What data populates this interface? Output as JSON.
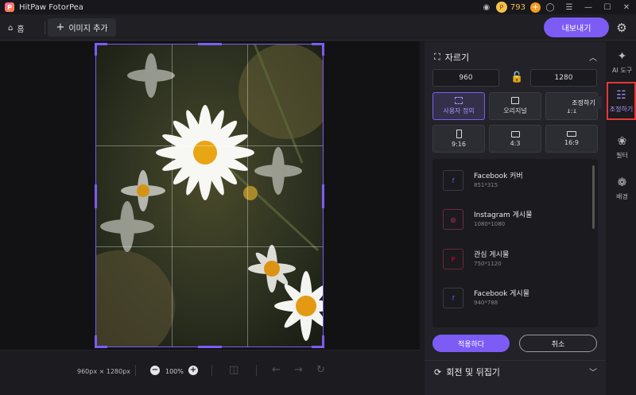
{
  "app": {
    "title": "HitPaw FotorPea"
  },
  "titlebar": {
    "coins": "793",
    "coin_symbol": "P",
    "plus": "+"
  },
  "toolbar": {
    "home_label": "홈",
    "add_image_label": "이미지 추가",
    "export_label": "내보내기"
  },
  "canvas": {
    "dimensions": "960px × 1280px",
    "zoom": "100%"
  },
  "crop_panel": {
    "title": "자르기",
    "width_value": "960",
    "height_value": "1280",
    "ratios": [
      {
        "label": "사용자 정의",
        "active": true
      },
      {
        "label": "오리지널",
        "active": false
      },
      {
        "label": "1:1",
        "active": false
      },
      {
        "label": "9:16",
        "active": false
      },
      {
        "label": "4:3",
        "active": false
      },
      {
        "label": "16:9",
        "active": false
      }
    ],
    "presets": [
      {
        "name": "Facebook 커버",
        "size": "851*315",
        "icon": "f",
        "color": "#3b6cf0"
      },
      {
        "name": "Instagram 게시물",
        "size": "1080*1080",
        "icon": "◎",
        "color": "#e1306c"
      },
      {
        "name": "관심 게시물",
        "size": "750*1120",
        "icon": "P",
        "color": "#e60023"
      },
      {
        "name": "Facebook 게시물",
        "size": "940*788",
        "icon": "f",
        "color": "#3b6cf0"
      }
    ],
    "apply_label": "적용하다",
    "cancel_label": "취소",
    "rotate_title": "회전 및 뒤집기"
  },
  "rail": {
    "items": [
      {
        "label": "AI 도구",
        "icon": "ai-tools-icon"
      },
      {
        "label": "조정하기",
        "icon": "sliders-icon",
        "active": true
      },
      {
        "label": "필터",
        "icon": "filter-icon"
      },
      {
        "label": "배경",
        "icon": "background-icon"
      }
    ],
    "tooltip": "조정하기"
  },
  "colors": {
    "accent": "#7c5cf5",
    "highlight": "#e53935"
  }
}
